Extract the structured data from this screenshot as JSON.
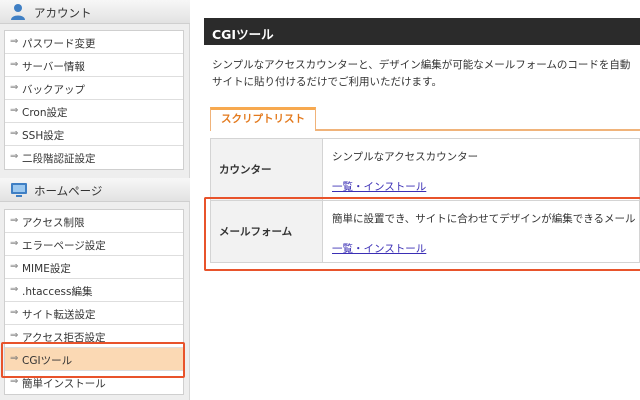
{
  "sidebar": {
    "account": {
      "label": "アカウント",
      "items": [
        {
          "label": "パスワード変更"
        },
        {
          "label": "サーバー情報"
        },
        {
          "label": "バックアップ"
        },
        {
          "label": "Cron設定"
        },
        {
          "label": "SSH設定"
        },
        {
          "label": "二段階認証設定"
        }
      ]
    },
    "homepage": {
      "label": "ホームページ",
      "items": [
        {
          "label": "アクセス制限"
        },
        {
          "label": "エラーページ設定"
        },
        {
          "label": "MIME設定"
        },
        {
          "label": ".htaccess編集"
        },
        {
          "label": "サイト転送設定"
        },
        {
          "label": "アクセス拒否設定"
        },
        {
          "label": "CGIツール",
          "active": true
        },
        {
          "label": "簡単インストール"
        }
      ]
    },
    "arrow_glyph": "⇒"
  },
  "main": {
    "title": "CGIツール",
    "description_line1": "シンプルなアクセスカウンターと、デザイン編集が可能なメールフォームのコードを自動",
    "description_line2": "サイトに貼り付けるだけでご利用いただけます。",
    "tab_label": "スクリプトリスト",
    "scripts": [
      {
        "name": "カウンター",
        "description": "シンプルなアクセスカウンター",
        "link": "一覧・インストール"
      },
      {
        "name": "メールフォーム",
        "description": "簡単に設置でき、サイトに合わせてデザインが編集できるメール",
        "link": "一覧・インストール"
      }
    ]
  },
  "colors": {
    "highlight": "#e8532b",
    "active_item": "#fbd9b4",
    "tab_accent": "#f7a94f",
    "title_bar": "#2b2b2b",
    "link": "#3b2fb5"
  },
  "icons": {
    "account": "user-icon",
    "homepage": "monitor-icon"
  }
}
